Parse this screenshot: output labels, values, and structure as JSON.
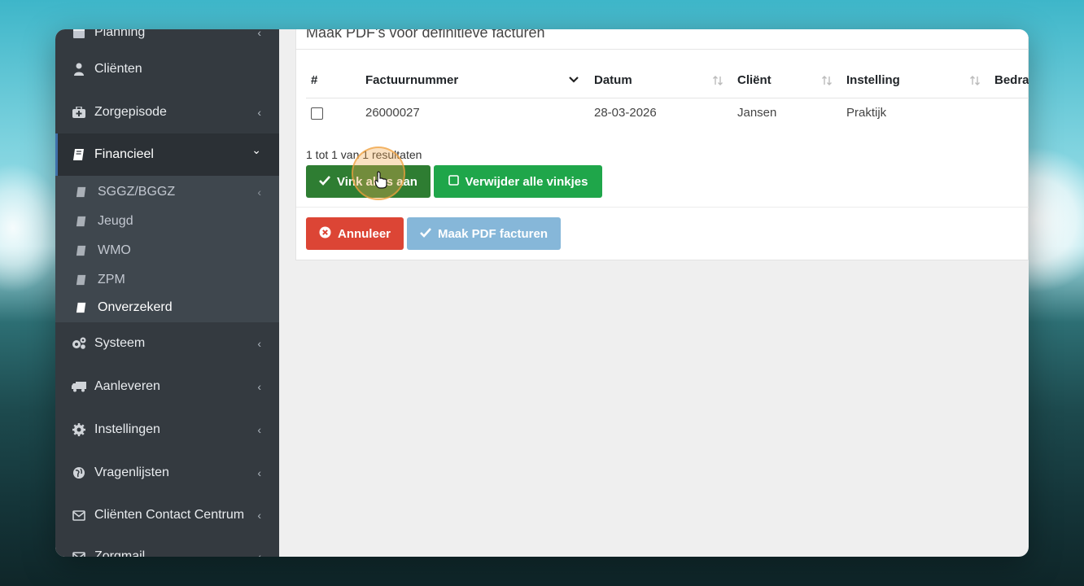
{
  "sidebar": {
    "items": [
      {
        "label": "Planning",
        "icon": "calendar-icon"
      },
      {
        "label": "Cliënten",
        "icon": "user-icon"
      },
      {
        "label": "Zorgepisode",
        "icon": "medkit-icon"
      },
      {
        "label": "Financieel",
        "icon": "book-icon"
      },
      {
        "label": "Systeem",
        "icon": "gears-icon"
      },
      {
        "label": "Aanleveren",
        "icon": "truck-icon"
      },
      {
        "label": "Instellingen",
        "icon": "gear-icon"
      },
      {
        "label": "Vragenlijsten",
        "icon": "globe-icon"
      },
      {
        "label": "Cliënten Contact Centrum",
        "icon": "envelope-icon"
      },
      {
        "label": "Zorgmail",
        "icon": "envelope-icon"
      }
    ],
    "subitems": [
      {
        "label": "SGGZ/BGGZ"
      },
      {
        "label": "Jeugd"
      },
      {
        "label": "WMO"
      },
      {
        "label": "ZPM"
      },
      {
        "label": "Onverzekerd"
      }
    ],
    "chevron_left": "‹",
    "chevron_down": "⌄"
  },
  "main": {
    "title": "Maak PDF's voor definitieve facturen",
    "table": {
      "headers": [
        "#",
        "Factuurnummer",
        "Datum",
        "Cliënt",
        "Instelling",
        "Bedrag"
      ],
      "rows": [
        {
          "factuurnummer": "26000027",
          "datum": "28-03-2026",
          "client": "Jansen",
          "instelling": "Praktijk"
        }
      ]
    },
    "results_text": "1 tot 1 van 1 resultaten",
    "buttons": {
      "select_all": "Vink alles aan",
      "deselect_all": "Verwijder alle vinkjes",
      "cancel": "Annuleer",
      "make_pdf": "Maak PDF facturen"
    }
  },
  "colors": {
    "sidebar_bg": "#343a40",
    "green_dark": "#2e7d32",
    "green": "#1fa64a",
    "red": "#dc4535",
    "blue_disabled": "#86b7d9"
  }
}
